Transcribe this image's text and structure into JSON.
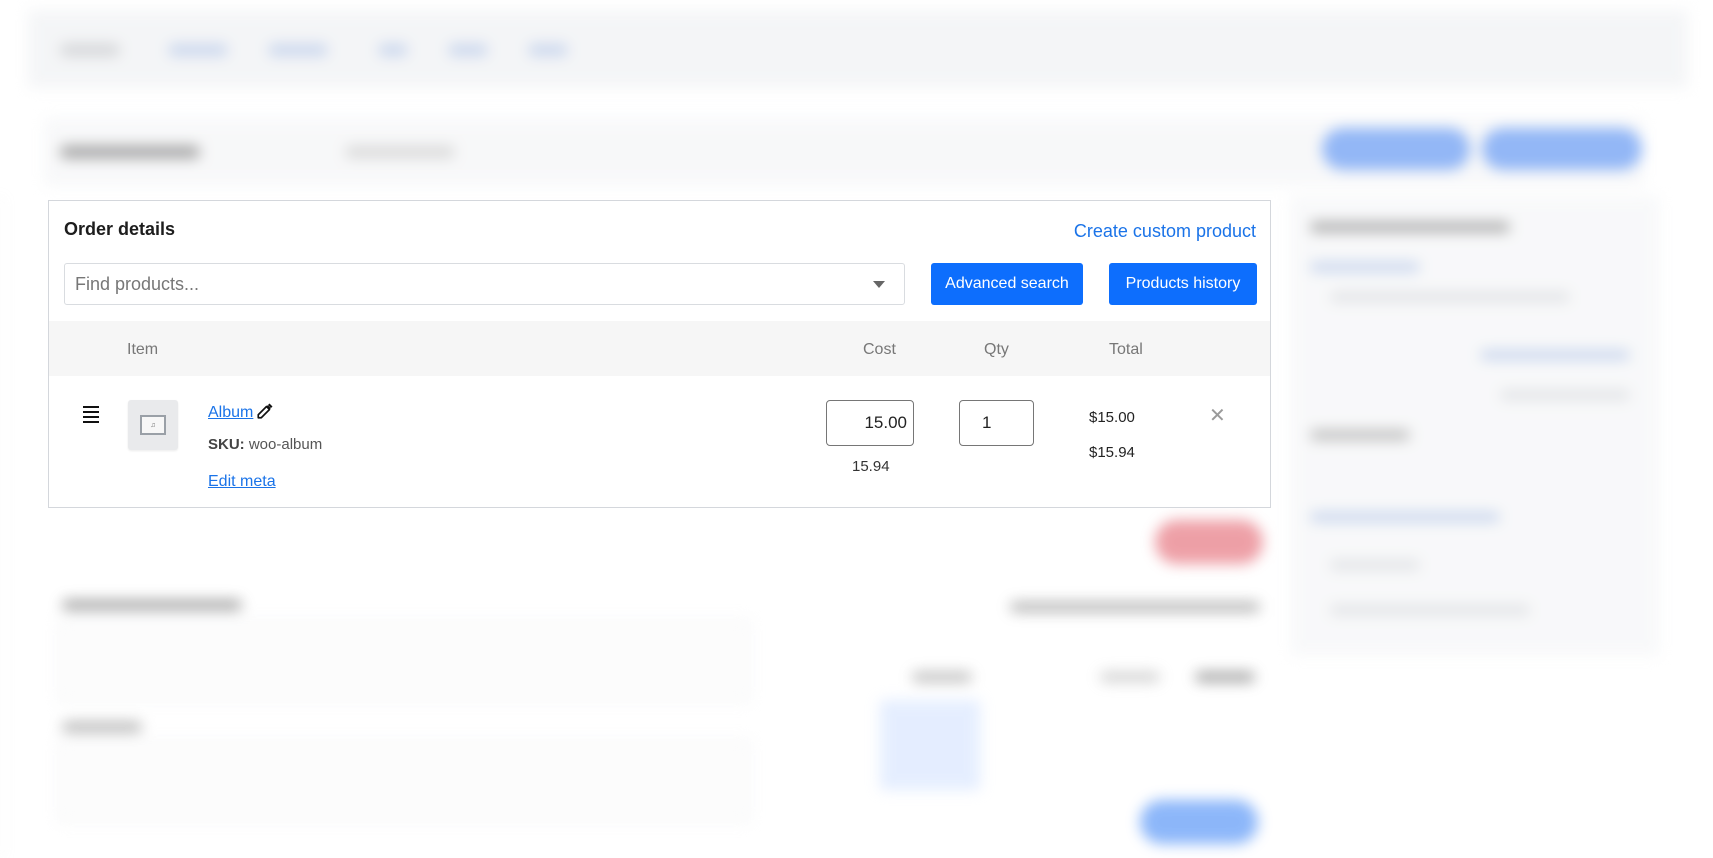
{
  "panel": {
    "title": "Order details",
    "create_custom_product": "Create custom product",
    "search_placeholder": "Find products...",
    "advanced_search_label": "Advanced search",
    "products_history_label": "Products history"
  },
  "table": {
    "headers": {
      "item": "Item",
      "cost": "Cost",
      "qty": "Qty",
      "total": "Total"
    },
    "rows": [
      {
        "name": "Album",
        "sku_label": "SKU:",
        "sku": "woo-album",
        "edit_meta": "Edit meta",
        "cost": "15.00",
        "cost_with_tax": "15.94",
        "qty": "1",
        "total": "$15.00",
        "total_with_tax": "$15.94"
      }
    ]
  },
  "icons": {
    "drag": "drag-handle-icon",
    "edit": "edit-icon",
    "remove": "close-icon",
    "dropdown": "chevron-down-icon"
  },
  "colors": {
    "accent": "#0d6efd",
    "link": "#1a73e8",
    "danger": "#e0525f"
  }
}
